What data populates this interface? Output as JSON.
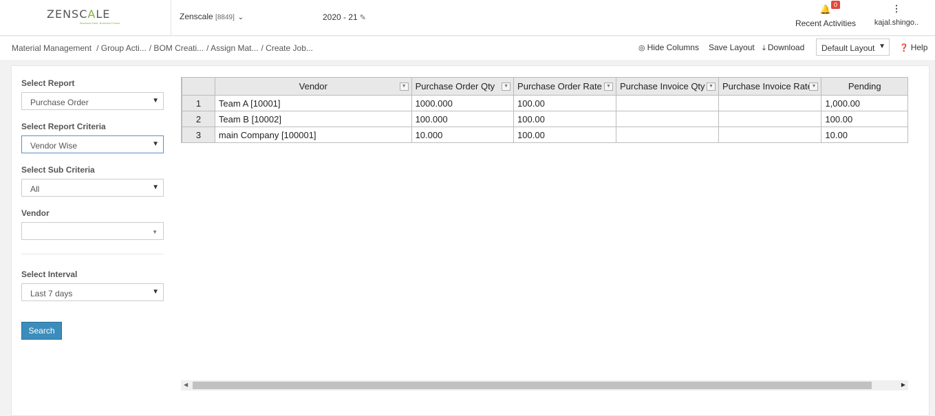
{
  "header": {
    "logo_text": "ZENSCALE",
    "logo_tagline": "Business Ease, Business Forces",
    "company_name": "Zenscale",
    "company_code": "[8849]",
    "year": "2020 - 21",
    "notification_count": "0",
    "recent_activities_label": "Recent Activities",
    "user_name": "kajal.shingo.."
  },
  "breadcrumb": [
    "Material Management",
    "/ Group Acti...",
    "/ BOM Creati...",
    "/ Assign Mat...",
    "/ Create Job..."
  ],
  "toolbar": {
    "hide_columns": "Hide Columns",
    "save_layout": "Save Layout",
    "download": "Download",
    "layout_select": "Default Layout",
    "help": "Help"
  },
  "filters": {
    "report_label": "Select Report",
    "report_value": "Purchase Order",
    "criteria_label": "Select Report Criteria",
    "criteria_value": "Vendor Wise",
    "sub_criteria_label": "Select Sub Criteria",
    "sub_criteria_value": "All",
    "vendor_label": "Vendor",
    "vendor_value": "",
    "interval_label": "Select Interval",
    "interval_value": "Last 7 days",
    "search_button": "Search"
  },
  "grid": {
    "columns": [
      "Vendor",
      "Purchase Order Qty",
      "Purchase Order Rate",
      "Purchase Invoice Qty",
      "Purchase Invoice Rate",
      "Pending"
    ],
    "rows": [
      {
        "index": "1",
        "vendor": "Team A [10001]",
        "po_qty": "1000.000",
        "po_rate": "100.00",
        "pi_qty": "",
        "pi_rate": "",
        "pending": "1,000.00"
      },
      {
        "index": "2",
        "vendor": "Team B [10002]",
        "po_qty": "100.000",
        "po_rate": "100.00",
        "pi_qty": "",
        "pi_rate": "",
        "pending": "100.00"
      },
      {
        "index": "3",
        "vendor": "main Company [100001]",
        "po_qty": "10.000",
        "po_rate": "100.00",
        "pi_qty": "",
        "pi_rate": "",
        "pending": "10.00"
      }
    ]
  },
  "colors": {
    "accent_button": "#3c8dbc",
    "badge": "#e2483b",
    "logo_green": "#7cb342"
  }
}
